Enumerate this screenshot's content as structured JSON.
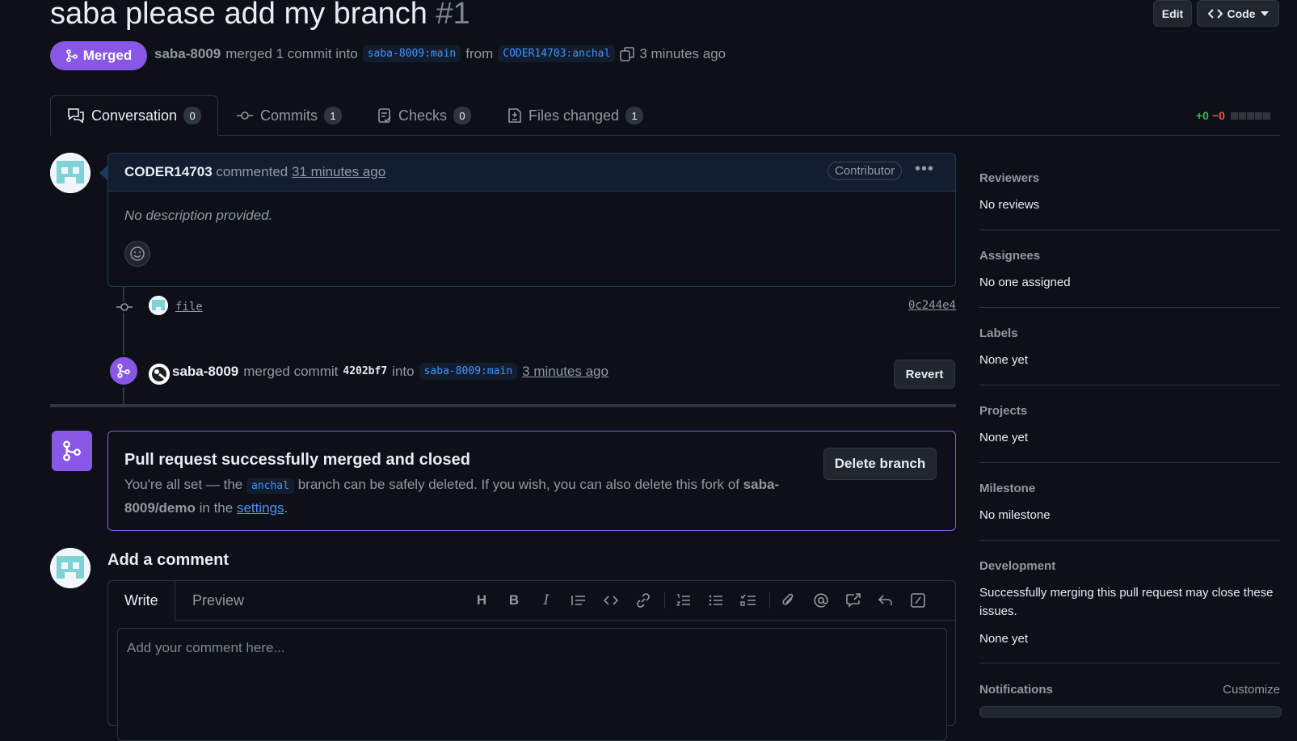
{
  "header": {
    "title": "saba please add my branch",
    "number": "#1",
    "edit_label": "Edit",
    "code_label": "Code"
  },
  "status": {
    "badge": "Merged",
    "author": "saba-8009",
    "action": "merged 1 commit into",
    "base_branch": "saba-8009:main",
    "from_word": "from",
    "head_branch": "CODER14703:anchal",
    "time": "3 minutes ago"
  },
  "tabs": [
    {
      "label": "Conversation",
      "count": "0"
    },
    {
      "label": "Commits",
      "count": "1"
    },
    {
      "label": "Checks",
      "count": "0"
    },
    {
      "label": "Files changed",
      "count": "1"
    }
  ],
  "diffstat": {
    "added": "+0",
    "removed": "−0"
  },
  "comment": {
    "author": "CODER14703",
    "verb": "commented",
    "time": "31 minutes ago",
    "role": "Contributor",
    "body": "No description provided."
  },
  "commit": {
    "message": "file",
    "sha": "0c244e4"
  },
  "merge_event": {
    "author": "saba-8009",
    "verb": "merged commit",
    "sha": "4202bf7",
    "into": "into",
    "branch": "saba-8009:main",
    "time": "3 minutes ago",
    "revert_label": "Revert"
  },
  "merged_box": {
    "title": "Pull request successfully merged and closed",
    "text_1": "You're all set — the",
    "branch": "anchal",
    "text_2": "branch can be safely deleted. If you wish, you can also delete this fork of",
    "repo": "saba-8009/demo",
    "text_3": "in the",
    "settings_link": "settings",
    "period": ".",
    "delete_label": "Delete branch"
  },
  "add_comment": {
    "title": "Add a comment",
    "write_tab": "Write",
    "preview_tab": "Preview",
    "placeholder": "Add your comment here..."
  },
  "sidebar": {
    "reviewers": {
      "label": "Reviewers",
      "value": "No reviews"
    },
    "assignees": {
      "label": "Assignees",
      "value": "No one assigned"
    },
    "labels": {
      "label": "Labels",
      "value": "None yet"
    },
    "projects": {
      "label": "Projects",
      "value": "None yet"
    },
    "milestone": {
      "label": "Milestone",
      "value": "No milestone"
    },
    "development": {
      "label": "Development",
      "description": "Successfully merging this pull request may close these issues.",
      "value": "None yet"
    },
    "notifications": {
      "label": "Notifications",
      "customize": "Customize"
    }
  },
  "colors": {
    "merged": "#8957e5",
    "link": "#4493f8",
    "bg": "#0d1117"
  }
}
